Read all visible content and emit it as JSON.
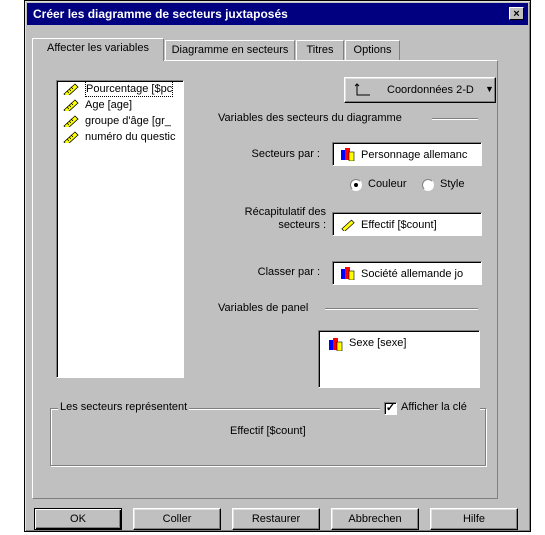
{
  "window": {
    "title": "Créer les diagramme de secteurs juxtaposés",
    "close": "×"
  },
  "tabs": [
    {
      "label": "Affecter les variables"
    },
    {
      "label": "Diagramme en secteurs"
    },
    {
      "label": "Titres"
    },
    {
      "label": "Options"
    }
  ],
  "variables": [
    {
      "label": "Pourcentage [$pc",
      "icon": "scale-ruler-icon"
    },
    {
      "label": "Age [age]",
      "icon": "scale-ruler-icon"
    },
    {
      "label": "groupe d'âge [gr_",
      "icon": "scale-ruler-icon"
    },
    {
      "label": "numéro du questic",
      "icon": "scale-ruler-icon"
    }
  ],
  "coordinates": {
    "label": "Coordonnées 2-D"
  },
  "slice_vars": {
    "heading": "Variables des secteurs du diagramme",
    "slices_by_label": "Secteurs par :",
    "slices_by_value": "Personnage allemanc",
    "color_label": "Couleur",
    "style_label": "Style",
    "color_selected": true,
    "summary_label_1": "Récapitulatif des",
    "summary_label_2": "secteurs :",
    "summary_value": "Effectif [$count]",
    "sort_label": "Classer par :",
    "sort_value": "Société allemande jo"
  },
  "panel": {
    "heading": "Variables de panel",
    "items": [
      {
        "label": "Sexe [sexe]"
      }
    ]
  },
  "represent": {
    "heading": "Les secteurs représentent",
    "show_key_label": "Afficher la clé",
    "show_key_checked": true,
    "value": "Effectif [$count]"
  },
  "buttons": {
    "ok": "OK",
    "paste": "Coller",
    "reset": "Restaurer",
    "cancel": "Abbrechen",
    "help": "Hilfe"
  }
}
